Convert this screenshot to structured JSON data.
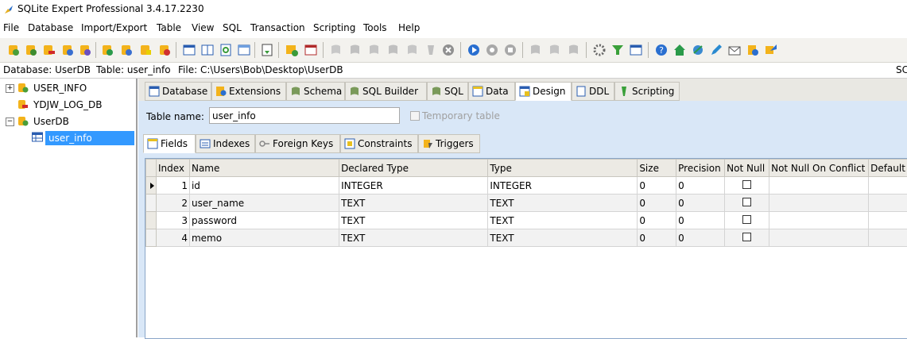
{
  "window": {
    "title": "SQLite Expert Professional 3.4.17.2230"
  },
  "menu": [
    "File",
    "Database",
    "Import/Export",
    "Table",
    "View",
    "SQL",
    "Transaction",
    "Scripting",
    "Tools",
    "Help"
  ],
  "infobar": {
    "database": "Database: UserDB",
    "table": "Table: user_info",
    "file": "File: C:\\Users\\Bob\\Desktop\\UserDB",
    "right_cut": "SC"
  },
  "tree": {
    "items": [
      "USER_INFO",
      "YDJW_LOG_DB",
      "UserDB",
      "user_info"
    ]
  },
  "main_tabs": [
    "Database",
    "Extensions",
    "Schema",
    "SQL Builder",
    "SQL",
    "Data",
    "Design",
    "DDL",
    "Scripting"
  ],
  "design": {
    "table_name_label": "Table name:",
    "table_name_value": "user_info",
    "temporary_label": "Temporary table",
    "sub_tabs": [
      "Fields",
      "Indexes",
      "Foreign Keys",
      "Constraints",
      "Triggers"
    ]
  },
  "grid": {
    "columns": [
      "Index",
      "Name",
      "Declared Type",
      "Type",
      "Size",
      "Precision",
      "Not Null",
      "Not Null On Conflict",
      "Default"
    ],
    "rows": [
      {
        "index": "1",
        "name": "id",
        "declared": "INTEGER",
        "type": "INTEGER",
        "size": "0",
        "precision": "0"
      },
      {
        "index": "2",
        "name": "user_name",
        "declared": "TEXT",
        "type": "TEXT",
        "size": "0",
        "precision": "0"
      },
      {
        "index": "3",
        "name": "password",
        "declared": "TEXT",
        "type": "TEXT",
        "size": "0",
        "precision": "0"
      },
      {
        "index": "4",
        "name": "memo",
        "declared": "TEXT",
        "type": "TEXT",
        "size": "0",
        "precision": "0"
      }
    ]
  },
  "colors": {
    "panel_bg": "#d9e7f7",
    "selection": "#3399ff",
    "toolbar_bg": "#f3f2ee"
  }
}
